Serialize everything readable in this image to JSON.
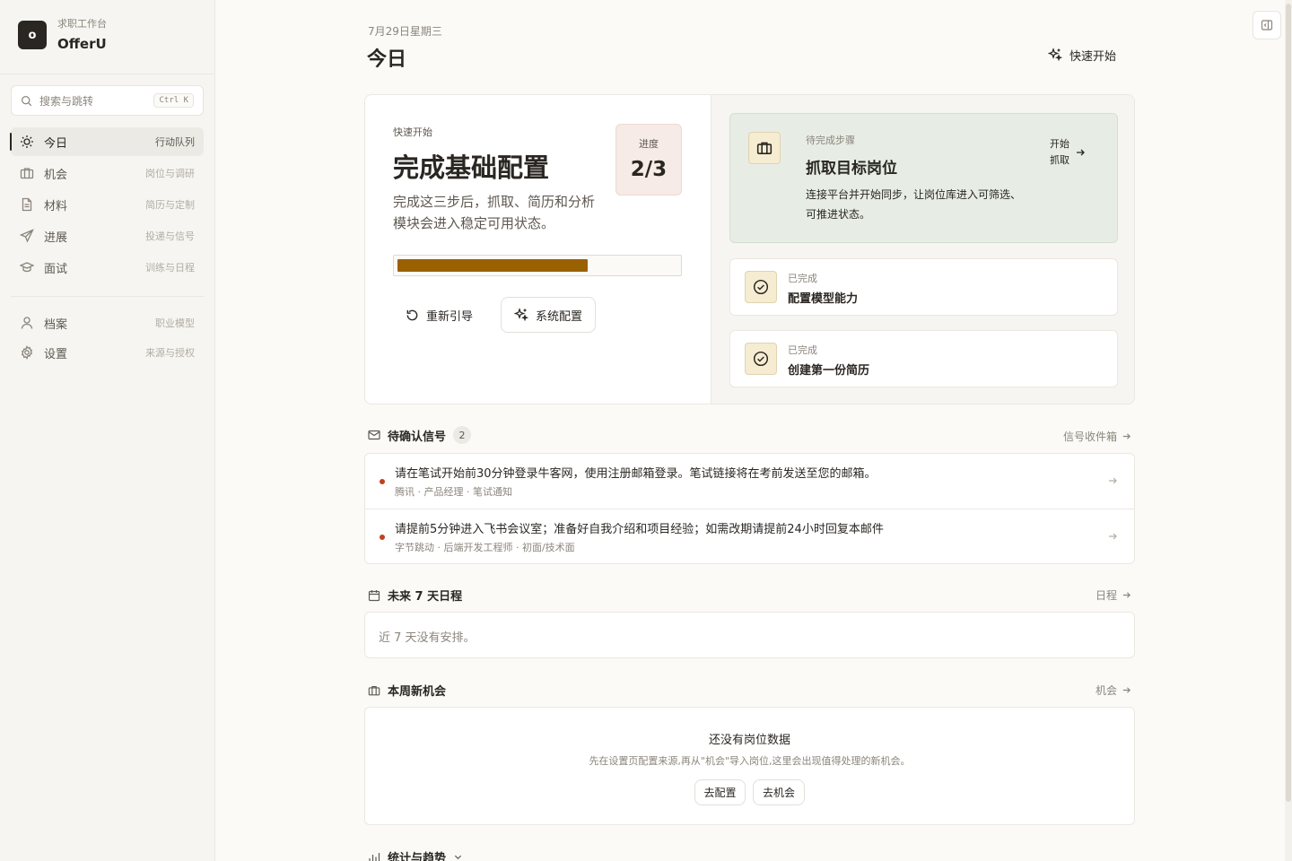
{
  "sidebar": {
    "logo_letter": "o",
    "workspace_label": "求职工作台",
    "app_name": "OfferU",
    "search": {
      "placeholder": "搜索与跳转",
      "shortcut": "Ctrl K"
    },
    "nav": [
      {
        "label": "今日",
        "hint": "行动队列",
        "icon": "sun-icon",
        "active": true
      },
      {
        "label": "机会",
        "hint": "岗位与调研",
        "icon": "briefcase-icon"
      },
      {
        "label": "材料",
        "hint": "简历与定制",
        "icon": "document-icon"
      },
      {
        "label": "进展",
        "hint": "投递与信号",
        "icon": "send-icon"
      },
      {
        "label": "面试",
        "hint": "训练与日程",
        "icon": "graduation-cap-icon"
      }
    ],
    "nav_secondary": [
      {
        "label": "档案",
        "hint": "职业模型",
        "icon": "user-icon"
      },
      {
        "label": "设置",
        "hint": "来源与授权",
        "icon": "gear-icon"
      }
    ]
  },
  "header": {
    "date": "7月29日星期三",
    "title": "今日",
    "quick_start_label": "快速开始"
  },
  "setup": {
    "kicker": "快速开始",
    "title": "完成基础配置",
    "description": "完成这三步后，抓取、简历和分析模块会进入稳定可用状态。",
    "progress_label": "进度",
    "progress_text": "2/3",
    "progress_fraction": 0.68,
    "restart_label": "重新引导",
    "system_config_label": "系统配置",
    "pending_step": {
      "kicker": "待完成步骤",
      "title": "抓取目标岗位",
      "description": "连接平台并开始同步，让岗位库进入可筛选、可推进状态。",
      "action_label": "开始抓取"
    },
    "done_steps": [
      {
        "kicker": "已完成",
        "title": "配置模型能力"
      },
      {
        "kicker": "已完成",
        "title": "创建第一份简历"
      }
    ],
    "colors": {
      "progress_fill": "#9a6100",
      "pending_bg": "#e7ede5",
      "progress_badge_bg": "#f6ebe6"
    }
  },
  "signals": {
    "title": "待确认信号",
    "count": "2",
    "link_label": "信号收件箱",
    "items": [
      {
        "text": "请在笔试开始前30分钟登录牛客网，使用注册邮箱登录。笔试链接将在考前发送至您的邮箱。",
        "meta": "腾讯 · 产品经理 · 笔试通知"
      },
      {
        "text": "请提前5分钟进入飞书会议室；准备好自我介绍和项目经验；如需改期请提前24小时回复本邮件",
        "meta": "字节跳动 · 后端开发工程师 · 初面/技术面"
      }
    ],
    "dot_color": "#c0411e"
  },
  "schedule": {
    "title": "未来 7 天日程",
    "link_label": "日程",
    "empty_text": "近 7 天没有安排。"
  },
  "opportunities": {
    "title": "本周新机会",
    "link_label": "机会",
    "empty_title": "还没有岗位数据",
    "empty_desc": "先在设置页配置来源,再从\"机会\"导入岗位,这里会出现值得处理的新机会。",
    "btn_config": "去配置",
    "btn_opportunities": "去机会"
  },
  "stats": {
    "title": "统计与趋势"
  }
}
